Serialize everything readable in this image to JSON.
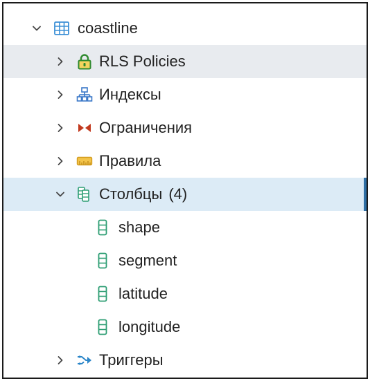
{
  "tree": {
    "table": {
      "label": "coastline",
      "icon": "table-icon",
      "expanded": true
    },
    "groups": [
      {
        "label": "RLS Policies",
        "icon": "lock-icon",
        "expanded": false
      },
      {
        "label": "Индексы",
        "icon": "index-icon",
        "expanded": false
      },
      {
        "label": "Ограничения",
        "icon": "constraint-icon",
        "expanded": false
      },
      {
        "label": "Правила",
        "icon": "rule-icon",
        "expanded": false
      },
      {
        "label": "Столбцы",
        "count": "(4)",
        "icon": "columns-icon",
        "expanded": true,
        "selected": true
      },
      {
        "label": "Триггеры",
        "icon": "trigger-icon",
        "expanded": false
      }
    ],
    "columns": [
      {
        "label": "shape",
        "icon": "column-icon"
      },
      {
        "label": "segment",
        "icon": "column-icon"
      },
      {
        "label": "latitude",
        "icon": "column-icon"
      },
      {
        "label": "longitude",
        "icon": "column-icon"
      }
    ]
  },
  "colors": {
    "hover_background": "#e8ebef",
    "selected_background": "#dcebf6",
    "selected_indicator": "#2f6fa5",
    "table_icon": "#3b8fd6",
    "column_icon": "#2e9e74",
    "lock_icon": "#3aa23a",
    "index_icon": "#3a78c8",
    "constraint_icon": "#c23a1f",
    "rule_icon": "#e8b22e",
    "trigger_icon": "#2b86c9"
  }
}
